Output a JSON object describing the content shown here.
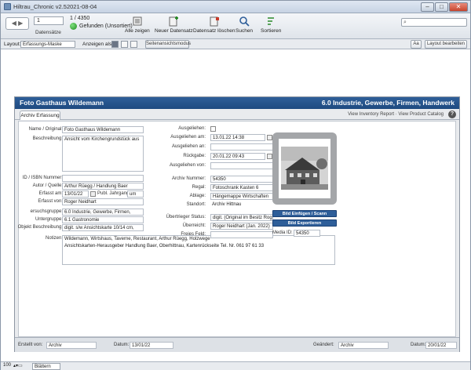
{
  "window": {
    "title": "Hiltrau_Chronic v2.52021-08-04"
  },
  "toolbar": {
    "record_number": "1",
    "record_label": "Datensätze",
    "record_count": "1 / 4350",
    "found_label": "Gefunden (Unsortiert)",
    "show_all": "Alle zeigen",
    "new_record": "Neuer Datensatz",
    "delete_record": "Datensatz löschen",
    "search": "Suchen",
    "sort": "Sortieren"
  },
  "layoutbar": {
    "layout_label": "Layout:",
    "layout_value": "Erfassungs-Maske",
    "view_label": "Anzeigen als:",
    "page_view": "Seitenansichtsmodus",
    "edit_layout": "Layout bearbeiten",
    "aa": "Aa"
  },
  "card": {
    "title_left": "Foto Gasthaus Wildemann",
    "title_right": "6.0 Industrie, Gewerbe, Firmen, Handwerk",
    "tab": "Archiv Erfassung",
    "links": "View Inventory Report  ·  View Product Catalog",
    "help": "?"
  },
  "form": {
    "name_label": "Name / Original:",
    "name_value": "Foto Gasthaus Wildemann",
    "desc_label": "Beschreibung:",
    "desc_value": "Ansicht vom Kirchengrundstück aus",
    "isbn_label": "ID / ISBN Nummer:",
    "isbn_value": "",
    "author_label": "Autor / Quelle:",
    "author_value": "Arthur Rüegg / Handlung Baer",
    "created_label": "Erfasst am:",
    "created_value": "13/01/22",
    "pub_label": "Publ. Jahrgang:",
    "pub_value": "um",
    "created_by_label": "Erfasst von:",
    "created_by_value": "Roger Neidhart",
    "group_label": "ersuchsgruppe:",
    "group_value": "6.0 Industrie, Gewerbe, Firmen,",
    "subgroup_label": "Untergruppe:",
    "subgroup_value": "6.1 Gastronomie",
    "objdesc_label": "Objekt Beschreibung:",
    "objdesc_value": "digit. s/w Ansichtskarte 10/14 cm,",
    "notes_label": "Notizen:",
    "notes_line1": "Wildemann, Wirtshaus, Taverne, Restaurant, Arthur Rüegg, Holzwege",
    "notes_line2": "Ansichtskarten-Herausgeber Handlung Baer, Oberhittnau, Kartenrückseite Tel. Nr. 061 97 61 33",
    "lent_label": "Ausgeliehen:",
    "lent_on_label": "Ausgeliehen am:",
    "lent_on_value": "13.01.22 14:38",
    "lent_to_label": "Ausgeliehen an:",
    "lent_to_value": "",
    "return_label": "Rückgabe:",
    "return_value": "20.01.22 09:43",
    "lent_by_label": "Ausgeliehen von:",
    "lent_by_value": "",
    "archive_no_label": "Archiv Nummer:",
    "archive_no_value": "54350",
    "rack_label": "Regal:",
    "rack_value": "Fotoschrank Kasten 6",
    "shelf_label": "Ablage:",
    "shelf_value": "Hängemappe Wirtschaften",
    "location_label": "Standort:",
    "location_value": "Archiv Hittnau",
    "transfer_label": "Übertrieger Status:",
    "transfer_value": "digit. (Original im Besitz Roger",
    "translator_label": "Überreicht:",
    "translator_value": "Roger Neidhart (Jan. 2022)",
    "free_label": "Freies Feld:",
    "free_value": "",
    "btn_add_image": "Bild Einfügen / Scann ansehen",
    "btn_export": "Bild Exportieren",
    "media_id_label": "Media ID:",
    "media_id_value": "54350"
  },
  "footer": {
    "created_by_label": "Erstellt von:",
    "created_by_value": "Archiv",
    "date_label": "Datum:",
    "date_value": "13/01/22",
    "changed_label": "Geändert:",
    "changed_value": "Archiv",
    "date2_label": "Datum:",
    "date2_value": "20/01/22"
  },
  "statusbar": {
    "zoom": "100",
    "mode": "Blättern"
  }
}
